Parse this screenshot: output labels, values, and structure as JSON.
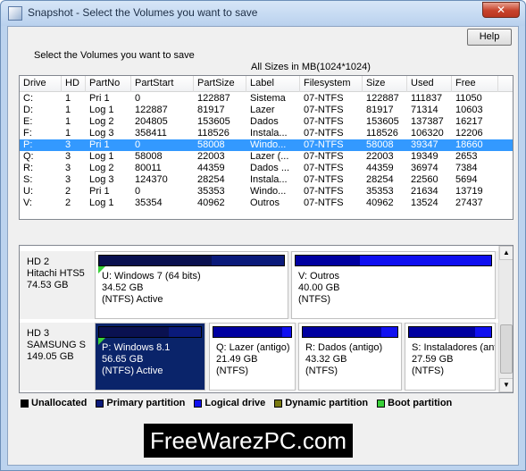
{
  "window": {
    "title": "Snapshot - Select the Volumes you want to save",
    "close_label": "✕"
  },
  "help_label": "Help",
  "instruction": "Select the Volumes you want to save",
  "sizes_note": "All Sizes in MB(1024*1024)",
  "columns": [
    "Drive",
    "HD",
    "PartNo",
    "PartStart",
    "PartSize",
    "Label",
    "Filesystem",
    "Size",
    "Used",
    "Free"
  ],
  "rows": [
    [
      "C:",
      "1",
      "Pri  1",
      "0",
      "122887",
      "Sistema",
      "07-NTFS",
      "122887",
      "111837",
      "11050"
    ],
    [
      "D:",
      "1",
      "Log  1",
      "122887",
      "81917",
      "Lazer",
      "07-NTFS",
      "81917",
      "71314",
      "10603"
    ],
    [
      "E:",
      "1",
      "Log  2",
      "204805",
      "153605",
      "Dados",
      "07-NTFS",
      "153605",
      "137387",
      "16217"
    ],
    [
      "F:",
      "1",
      "Log  3",
      "358411",
      "118526",
      "Instala...",
      "07-NTFS",
      "118526",
      "106320",
      "12206"
    ],
    [
      "P:",
      "3",
      "Pri  1",
      "0",
      "58008",
      "Windo...",
      "07-NTFS",
      "58008",
      "39347",
      "18660"
    ],
    [
      "Q:",
      "3",
      "Log  1",
      "58008",
      "22003",
      "Lazer (...",
      "07-NTFS",
      "22003",
      "19349",
      "2653"
    ],
    [
      "R:",
      "3",
      "Log  2",
      "80011",
      "44359",
      "Dados ...",
      "07-NTFS",
      "44359",
      "36974",
      "7384"
    ],
    [
      "S:",
      "3",
      "Log  3",
      "124370",
      "28254",
      "Instala...",
      "07-NTFS",
      "28254",
      "22560",
      "5694"
    ],
    [
      "U:",
      "2",
      "Pri  1",
      "0",
      "35353",
      "Windo...",
      "07-NTFS",
      "35353",
      "21634",
      "13719"
    ],
    [
      "V:",
      "2",
      "Log  1",
      "35354",
      "40962",
      "Outros",
      "07-NTFS",
      "40962",
      "13524",
      "27437"
    ]
  ],
  "selected_row": 4,
  "disks": [
    {
      "name": "HD 2",
      "model": "Hitachi HTS5",
      "size": "74.53 GB",
      "partitions": [
        {
          "line1": "U: Windows 7 (64 bits)",
          "line2": "34.52 GB",
          "line3": "(NTFS) Active",
          "kind": "primary",
          "used_fraction": 0.61,
          "boot": true,
          "active": false
        },
        {
          "line1": "V: Outros",
          "line2": "40.00 GB",
          "line3": "(NTFS)",
          "kind": "logical",
          "used_fraction": 0.33,
          "boot": false,
          "active": false
        }
      ]
    },
    {
      "name": "HD 3",
      "model": "SAMSUNG S",
      "size": "149.05 GB",
      "partitions": [
        {
          "line1": "P: Windows 8.1",
          "line2": "56.65 GB",
          "line3": "(NTFS) Active",
          "kind": "primary",
          "used_fraction": 0.68,
          "boot": true,
          "active": true
        },
        {
          "line1": "Q: Lazer (antigo)",
          "line2": "21.49 GB",
          "line3": "(NTFS)",
          "kind": "logical",
          "used_fraction": 0.88,
          "boot": false,
          "active": false
        },
        {
          "line1": "R: Dados (antigo)",
          "line2": "43.32 GB",
          "line3": "(NTFS)",
          "kind": "logical",
          "used_fraction": 0.83,
          "boot": false,
          "active": false
        },
        {
          "line1": "S: Instaladores (antigo)",
          "line2": "27.59 GB",
          "line3": "(NTFS)",
          "kind": "logical",
          "used_fraction": 0.8,
          "boot": false,
          "active": false
        }
      ]
    }
  ],
  "legend": [
    {
      "label": "Unallocated",
      "color": "#000000"
    },
    {
      "label": "Primary partition",
      "color": "#0a1a7a"
    },
    {
      "label": "Logical drive",
      "color": "#1010f0"
    },
    {
      "label": "Dynamic partition",
      "color": "#7a7a10"
    },
    {
      "label": "Boot partition",
      "color": "#38d038"
    }
  ],
  "colors": {
    "primary": "#0a1a7a",
    "logical": "#1010f0",
    "selection": "#3399ff"
  },
  "watermark": "FreeWarezPC.com"
}
